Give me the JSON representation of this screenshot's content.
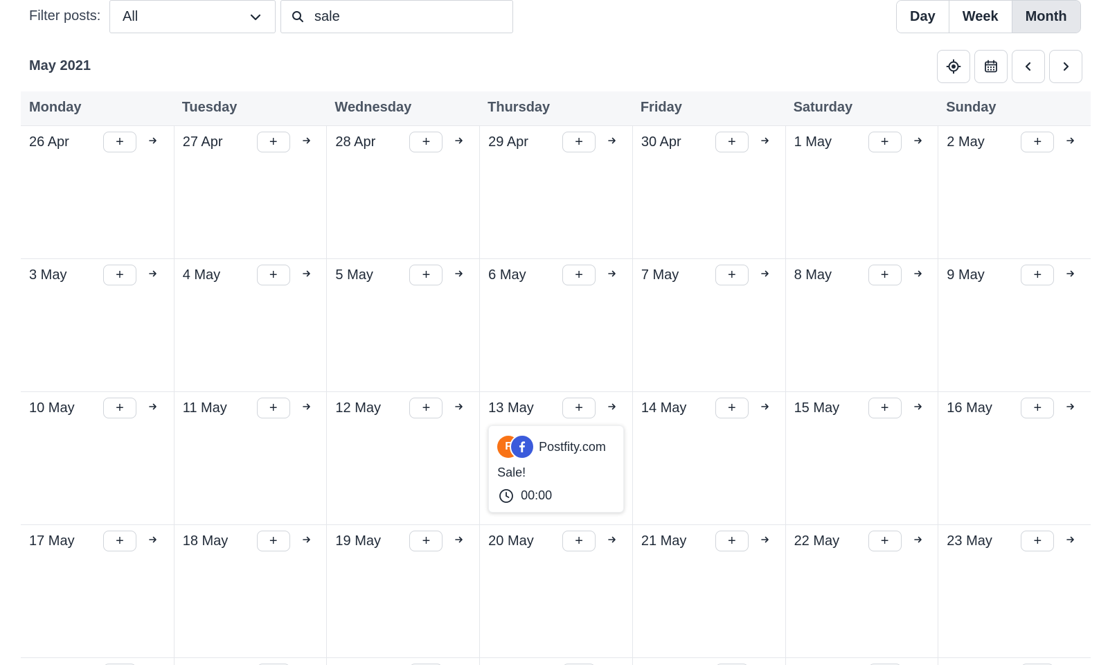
{
  "filter": {
    "label": "Filter posts:",
    "selected": "All",
    "search_value": "sale"
  },
  "views": [
    {
      "label": "Day",
      "active": false
    },
    {
      "label": "Week",
      "active": false
    },
    {
      "label": "Month",
      "active": true
    }
  ],
  "month_title": "May 2021",
  "nav_icons": [
    "locate-icon",
    "calendar-icon",
    "chevron-left-icon",
    "chevron-right-icon"
  ],
  "weekdays": [
    "Monday",
    "Tuesday",
    "Wednesday",
    "Thursday",
    "Friday",
    "Saturday",
    "Sunday"
  ],
  "add_label": "+",
  "weeks": [
    [
      "26 Apr",
      "27 Apr",
      "28 Apr",
      "29 Apr",
      "30 Apr",
      "1 May",
      "2 May"
    ],
    [
      "3 May",
      "4 May",
      "5 May",
      "6 May",
      "7 May",
      "8 May",
      "9 May"
    ],
    [
      "10 May",
      "11 May",
      "12 May",
      "13 May",
      "14 May",
      "15 May",
      "16 May"
    ],
    [
      "17 May",
      "18 May",
      "19 May",
      "20 May",
      "21 May",
      "22 May",
      "23 May"
    ]
  ],
  "post": {
    "account": "Postfity.com",
    "text": "Sale!",
    "time": "00:00",
    "network": "facebook-icon"
  },
  "colors": {
    "accent_brand": "#f97316",
    "facebook": "#3b5bdb",
    "active_view_bg": "#e5e7eb"
  }
}
